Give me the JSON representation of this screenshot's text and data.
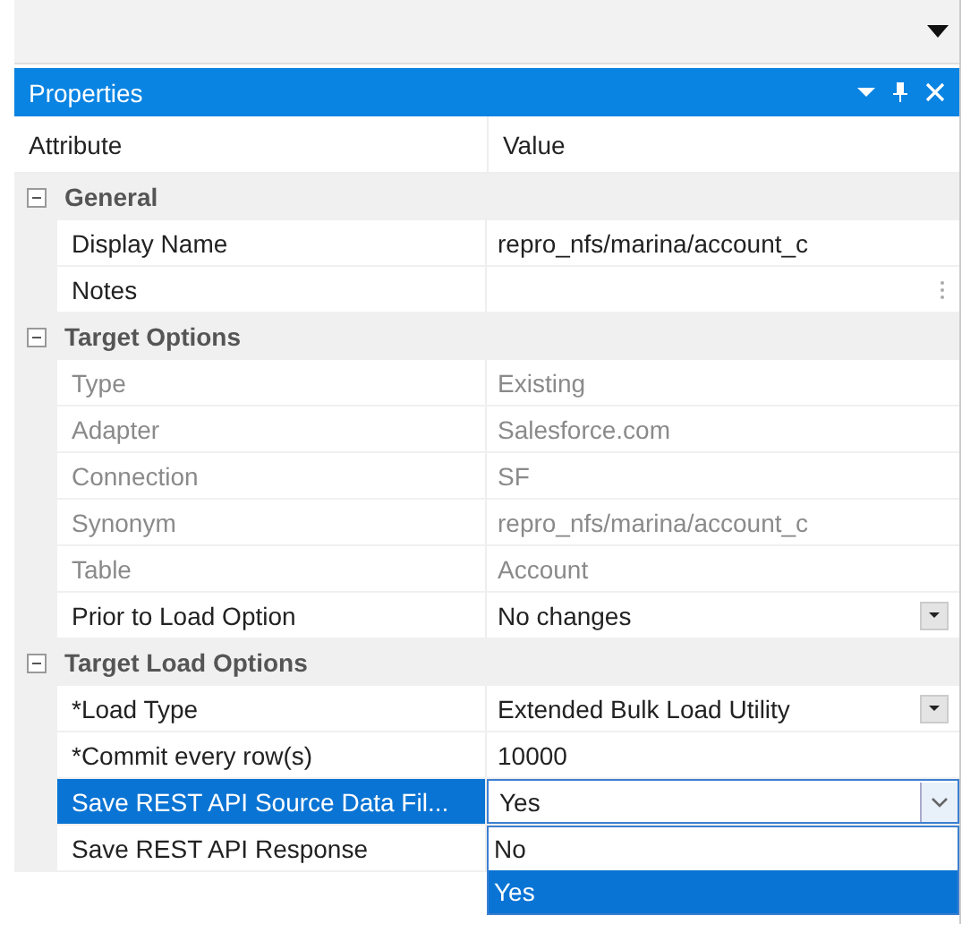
{
  "panel": {
    "title": "Properties"
  },
  "columns": [
    "Attribute",
    "Value"
  ],
  "rows": [
    {
      "kind": "group",
      "label": "General",
      "expanded": true
    },
    {
      "kind": "text",
      "label": "Display Name",
      "value": "repro_nfs/marina/account_c",
      "disabled": false,
      "selected": false
    },
    {
      "kind": "notes",
      "label": "Notes",
      "disabled": false,
      "selected": false
    },
    {
      "kind": "group",
      "label": "Target Options",
      "expanded": true
    },
    {
      "kind": "text",
      "label": "Type",
      "value": "Existing",
      "disabled": true,
      "selected": false
    },
    {
      "kind": "text",
      "label": "Adapter",
      "value": "Salesforce.com",
      "disabled": true,
      "selected": false
    },
    {
      "kind": "text",
      "label": "Connection",
      "value": "SF",
      "disabled": true,
      "selected": false
    },
    {
      "kind": "text",
      "label": "Synonym",
      "value": "repro_nfs/marina/account_c",
      "disabled": true,
      "selected": false
    },
    {
      "kind": "text",
      "label": "Table",
      "value": "Account",
      "disabled": true,
      "selected": false
    },
    {
      "kind": "combo",
      "label": "Prior to Load Option",
      "value": "No changes",
      "disabled": false,
      "selected": false
    },
    {
      "kind": "group",
      "label": "Target Load Options",
      "expanded": true
    },
    {
      "kind": "combo",
      "label": "*Load Type",
      "value": "Extended Bulk Load Utility",
      "disabled": false,
      "selected": false
    },
    {
      "kind": "text",
      "label": "*Commit every row(s)",
      "value": "10000",
      "disabled": false,
      "selected": false
    },
    {
      "kind": "dropdown",
      "label": "Save REST API Source Data Fil...",
      "value": "Yes",
      "disabled": false,
      "selected": true,
      "options": [
        {
          "label": "No",
          "selected": false
        },
        {
          "label": "Yes",
          "selected": true
        }
      ]
    },
    {
      "kind": "text",
      "label": "Save REST API Response",
      "disabled": false,
      "selected": false
    }
  ]
}
